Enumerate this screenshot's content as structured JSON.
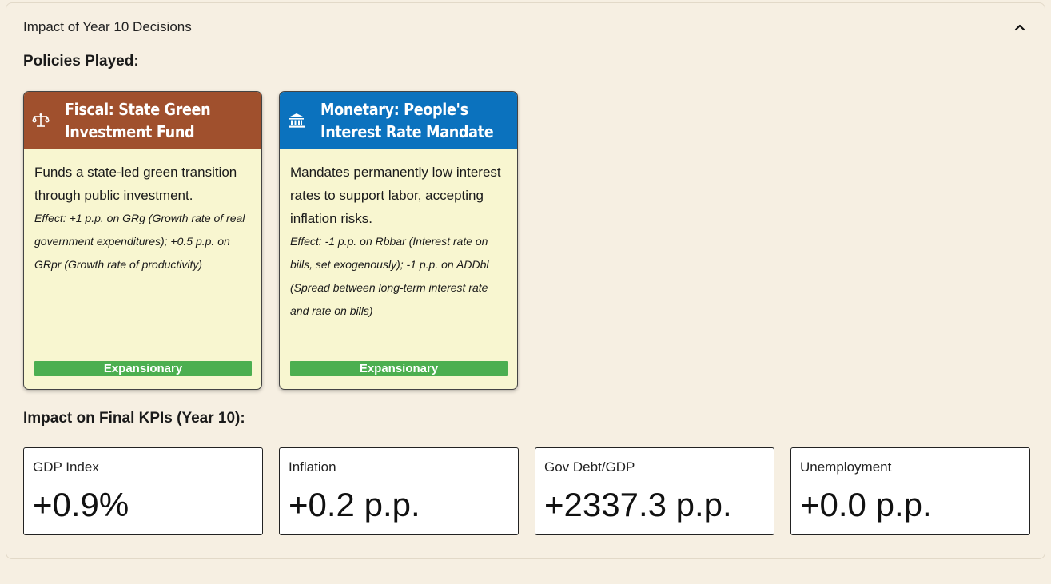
{
  "panel": {
    "title": "Impact of Year 10 Decisions",
    "collapse_icon": "chevron-up-icon"
  },
  "policies": {
    "heading": "Policies Played:",
    "cards": [
      {
        "title": "Fiscal: State Green Investment Fund",
        "icon": "scales-icon",
        "header_color": "#a0502d",
        "description": "Funds a state-led green transition through public investment.",
        "effect": "Effect: +1 p.p. on GRg (Growth rate of real government expenditures); +0.5 p.p. on GRpr (Growth rate of productivity)",
        "badge": "Expansionary",
        "badge_color": "#4caf50"
      },
      {
        "title": "Monetary: People's Interest Rate Mandate",
        "icon": "bank-icon",
        "header_color": "#0b72be",
        "description": "Mandates permanently low interest rates to support labor, accepting inflation risks.",
        "effect": "Effect: -1 p.p. on Rbbar (Interest rate on bills, set exogenously); -1 p.p. on ADDbl (Spread between long-term interest rate and rate on bills)",
        "badge": "Expansionary",
        "badge_color": "#4caf50"
      }
    ]
  },
  "kpis": {
    "heading": "Impact on Final KPIs (Year 10):",
    "items": [
      {
        "label": "GDP Index",
        "value": "+0.9%"
      },
      {
        "label": "Inflation",
        "value": "+0.2 p.p."
      },
      {
        "label": "Gov Debt/GDP",
        "value": "+2337.3 p.p."
      },
      {
        "label": "Unemployment",
        "value": "+0.0 p.p."
      }
    ]
  }
}
